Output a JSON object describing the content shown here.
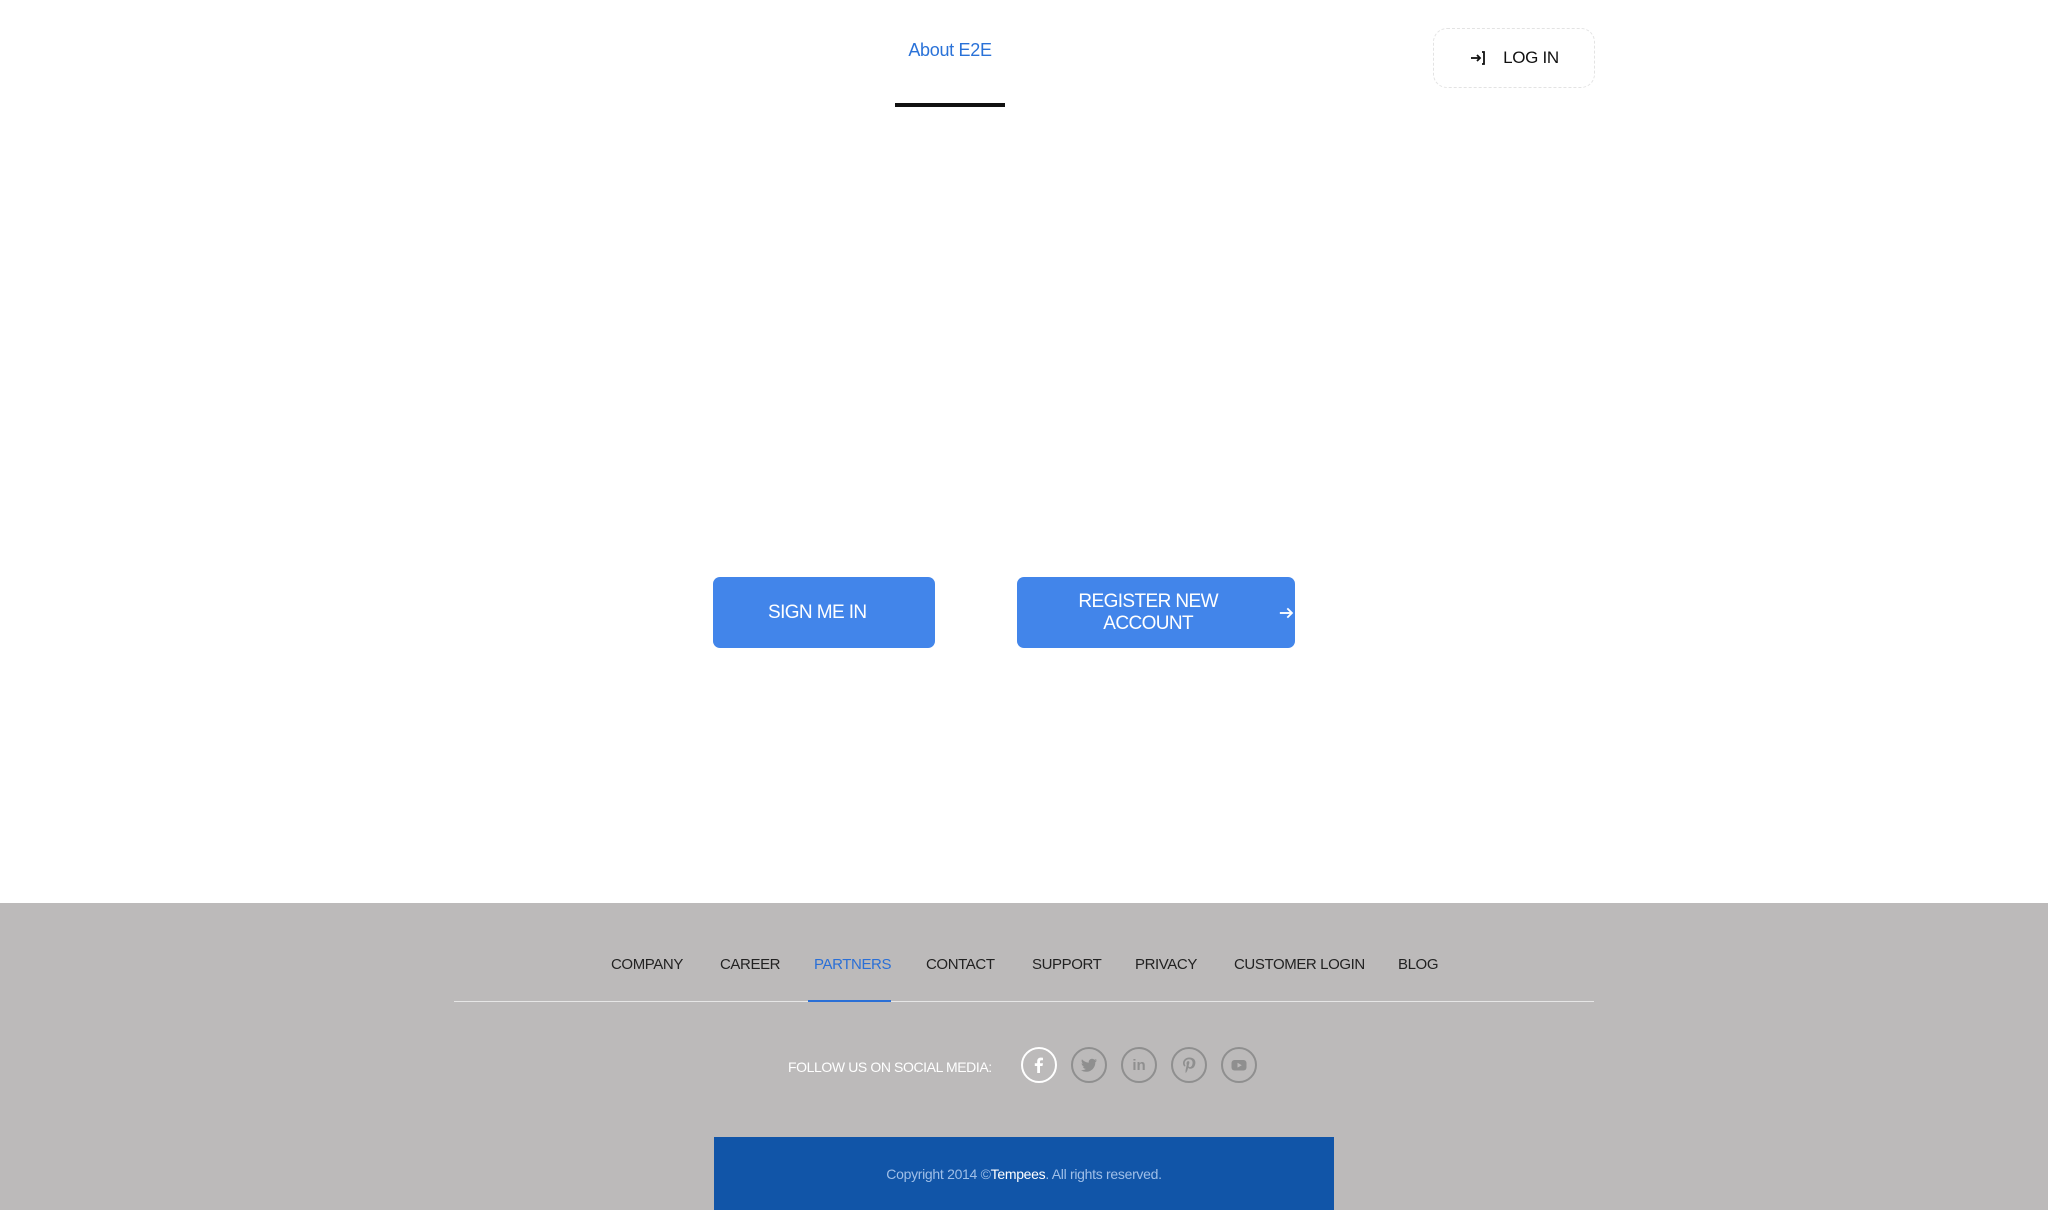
{
  "header": {
    "nav_about": "About E2E",
    "login_label": "LOG IN"
  },
  "main": {
    "sign_in_label": "SIGN ME IN",
    "register_label": "REGISTER NEW ACCOUNT"
  },
  "footer": {
    "links": [
      {
        "label": "COMPANY"
      },
      {
        "label": "CAREER"
      },
      {
        "label": "PARTNERS",
        "active": true
      },
      {
        "label": "CONTACT"
      },
      {
        "label": "SUPPORT"
      },
      {
        "label": "PRIVACY"
      },
      {
        "label": "CUSTOMER LOGIN"
      },
      {
        "label": "BLOG"
      }
    ],
    "follow_label": "FOLLOW US ON SOCIAL MEDIA:",
    "social": [
      "facebook-icon",
      "twitter-icon",
      "linkedin-icon",
      "pinterest-icon",
      "youtube-icon"
    ],
    "copyright_prefix": "Copyright 2014 © ",
    "copyright_brand": "Tempees",
    "copyright_suffix": ". All rights reserved."
  },
  "colors": {
    "accent": "#4285ea",
    "link_active": "#2a6fd6",
    "footer_bg": "#bcbaba",
    "copyright_bg": "#1155a8"
  }
}
